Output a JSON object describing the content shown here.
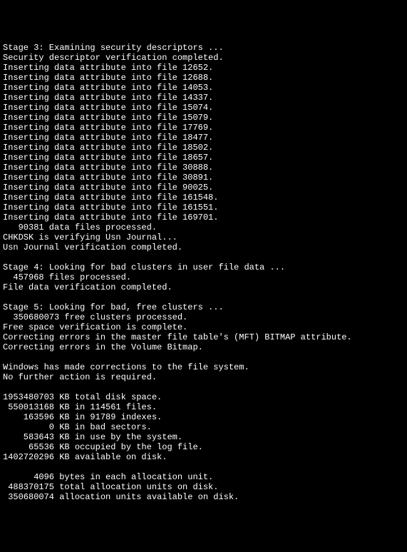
{
  "console": {
    "lines": [
      "Stage 3: Examining security descriptors ...",
      "Security descriptor verification completed.",
      "Inserting data attribute into file 12652.",
      "Inserting data attribute into file 12688.",
      "Inserting data attribute into file 14053.",
      "Inserting data attribute into file 14337.",
      "Inserting data attribute into file 15074.",
      "Inserting data attribute into file 15079.",
      "Inserting data attribute into file 17769.",
      "Inserting data attribute into file 18477.",
      "Inserting data attribute into file 18502.",
      "Inserting data attribute into file 18657.",
      "Inserting data attribute into file 30888.",
      "Inserting data attribute into file 30891.",
      "Inserting data attribute into file 90025.",
      "Inserting data attribute into file 161548.",
      "Inserting data attribute into file 161551.",
      "Inserting data attribute into file 169701.",
      "   90381 data files processed.",
      "CHKDSK is verifying Usn Journal...",
      "Usn Journal verification completed.",
      "",
      "Stage 4: Looking for bad clusters in user file data ...",
      "  457968 files processed.",
      "File data verification completed.",
      "",
      "Stage 5: Looking for bad, free clusters ...",
      "  350680073 free clusters processed.",
      "Free space verification is complete.",
      "Correcting errors in the master file table's (MFT) BITMAP attribute.",
      "Correcting errors in the Volume Bitmap.",
      "",
      "Windows has made corrections to the file system.",
      "No further action is required.",
      "",
      "1953480703 KB total disk space.",
      " 550013168 KB in 114561 files.",
      "    163596 KB in 91789 indexes.",
      "         0 KB in bad sectors.",
      "    583643 KB in use by the system.",
      "     65536 KB occupied by the log file.",
      "1402720296 KB available on disk.",
      "",
      "      4096 bytes in each allocation unit.",
      " 488370175 total allocation units on disk.",
      " 350680074 allocation units available on disk."
    ]
  }
}
